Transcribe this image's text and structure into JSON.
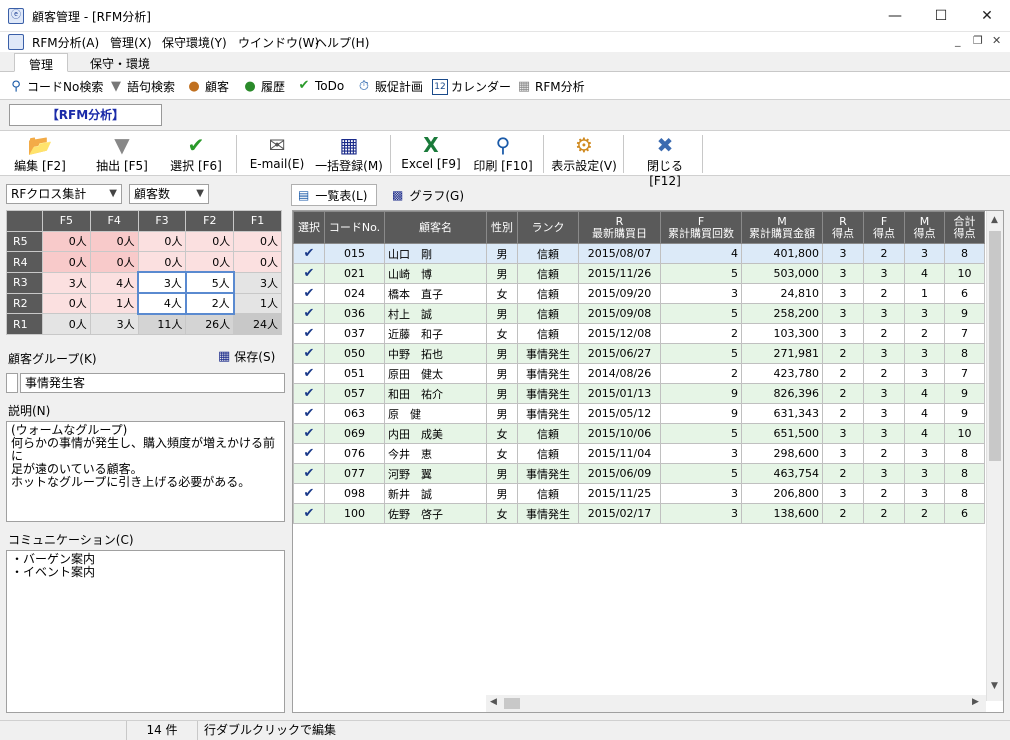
{
  "window": {
    "title": "顧客管理 - [RFM分析]",
    "app_icon": "ⓔ"
  },
  "menu": [
    "RFM分析(A)",
    "管理(X)",
    "保守環境(Y)",
    "ウインドウ(W)",
    "ヘルプ(H)"
  ],
  "tabs": [
    "管理",
    "保守・環境"
  ],
  "nav": [
    {
      "label": "コードNo検索",
      "icon": "search-icon"
    },
    {
      "label": "語句検索",
      "icon": "funnel-icon"
    },
    {
      "label": "顧客",
      "icon": "customer-icon"
    },
    {
      "label": "履歴",
      "icon": "history-icon"
    },
    {
      "label": "ToDo",
      "icon": "check-icon"
    },
    {
      "label": "販促計画",
      "icon": "timer-icon"
    },
    {
      "label": "カレンダー",
      "icon": "calendar-icon"
    },
    {
      "label": "RFM分析",
      "icon": "grid-icon"
    }
  ],
  "section_title": "【RFM分析】",
  "toolbar": [
    {
      "label": "編集 [F2]",
      "icon": "folder-icon"
    },
    {
      "label": "抽出 [F5]",
      "icon": "funnel-icon"
    },
    {
      "label": "選択 [F6]",
      "icon": "check-icon"
    },
    {
      "label": "E-mail(E)",
      "icon": "mail-icon"
    },
    {
      "label": "一括登録(M)",
      "icon": "save-icon"
    },
    {
      "label": "Excel [F9]",
      "icon": "excel-icon"
    },
    {
      "label": "印刷 [F10]",
      "icon": "print-icon"
    },
    {
      "label": "表示設定(V)",
      "icon": "settings-icon"
    },
    {
      "label": "閉じる [F12]",
      "icon": "close-icon"
    }
  ],
  "left": {
    "combo1": "RFクロス集計",
    "combo2": "顧客数",
    "rf_header": [
      "F5",
      "F4",
      "F3",
      "F2",
      "F1"
    ],
    "rf_rows": [
      {
        "r": "R5",
        "cells": [
          "0人",
          "0人",
          "0人",
          "0人",
          "0人"
        ]
      },
      {
        "r": "R4",
        "cells": [
          "0人",
          "0人",
          "0人",
          "0人",
          "0人"
        ]
      },
      {
        "r": "R3",
        "cells": [
          "3人",
          "4人",
          "3人",
          "5人",
          "3人"
        ]
      },
      {
        "r": "R2",
        "cells": [
          "0人",
          "1人",
          "4人",
          "2人",
          "1人"
        ]
      },
      {
        "r": "R1",
        "cells": [
          "0人",
          "3人",
          "11人",
          "26人",
          "24人"
        ]
      }
    ],
    "group_label": "顧客グループ(K)",
    "save_label": "保存(S)",
    "group_value": "事情発生客",
    "desc_label": "説明(N)",
    "desc_text": "(ウォームなグループ)\n何らかの事情が発生し、購入頻度が増えかける前に\n足が遠のいている顧客。\nホットなグループに引き上げる必要がある。",
    "comm_label": "コミュニケーション(C)",
    "comm_text": "・バーゲン案内\n・イベント案内"
  },
  "subtabs": [
    "一覧表(L)",
    "グラフ(G)"
  ],
  "columns": [
    "選択",
    "コードNo.",
    "顧客名",
    "性別",
    "ランク",
    "R\n最新購買日",
    "F\n累計購買回数",
    "M\n累計購買金額",
    "R\n得点",
    "F\n得点",
    "M\n得点",
    "合計\n得点"
  ],
  "rows": [
    [
      "015",
      "山口　剛",
      "男",
      "信頼",
      "2015/08/07",
      "4",
      "401,800",
      "3",
      "2",
      "3",
      "8"
    ],
    [
      "021",
      "山崎　博",
      "男",
      "信頼",
      "2015/11/26",
      "5",
      "503,000",
      "3",
      "3",
      "4",
      "10"
    ],
    [
      "024",
      "橋本　直子",
      "女",
      "信頼",
      "2015/09/20",
      "3",
      "24,810",
      "3",
      "2",
      "1",
      "6"
    ],
    [
      "036",
      "村上　誠",
      "男",
      "信頼",
      "2015/09/08",
      "5",
      "258,200",
      "3",
      "3",
      "3",
      "9"
    ],
    [
      "037",
      "近藤　和子",
      "女",
      "信頼",
      "2015/12/08",
      "2",
      "103,300",
      "3",
      "2",
      "2",
      "7"
    ],
    [
      "050",
      "中野　拓也",
      "男",
      "事情発生",
      "2015/06/27",
      "5",
      "271,981",
      "2",
      "3",
      "3",
      "8"
    ],
    [
      "051",
      "原田　健太",
      "男",
      "事情発生",
      "2014/08/26",
      "2",
      "423,780",
      "2",
      "2",
      "3",
      "7"
    ],
    [
      "057",
      "和田　祐介",
      "男",
      "事情発生",
      "2015/01/13",
      "9",
      "826,396",
      "2",
      "3",
      "4",
      "9"
    ],
    [
      "063",
      "原　健",
      "男",
      "事情発生",
      "2015/05/12",
      "9",
      "631,343",
      "2",
      "3",
      "4",
      "9"
    ],
    [
      "069",
      "内田　成美",
      "女",
      "信頼",
      "2015/10/06",
      "5",
      "651,500",
      "3",
      "3",
      "4",
      "10"
    ],
    [
      "076",
      "今井　恵",
      "女",
      "信頼",
      "2015/11/04",
      "3",
      "298,600",
      "3",
      "2",
      "3",
      "8"
    ],
    [
      "077",
      "河野　翼",
      "男",
      "事情発生",
      "2015/06/09",
      "5",
      "463,754",
      "2",
      "3",
      "3",
      "8"
    ],
    [
      "098",
      "新井　誠",
      "男",
      "信頼",
      "2015/11/25",
      "3",
      "206,800",
      "3",
      "2",
      "3",
      "8"
    ],
    [
      "100",
      "佐野　啓子",
      "女",
      "事情発生",
      "2015/02/17",
      "3",
      "138,600",
      "2",
      "2",
      "2",
      "6"
    ]
  ],
  "check_mark": "✔",
  "status": {
    "count": "14 件",
    "hint": "行ダブルクリックで編集"
  }
}
